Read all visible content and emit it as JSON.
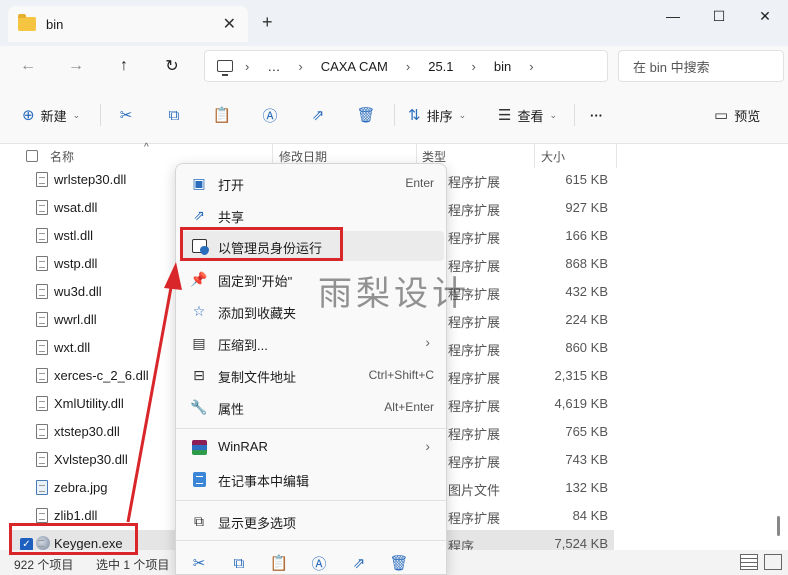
{
  "window": {
    "tab_title": "bin",
    "tab_close": "✕",
    "new_tab": "+",
    "minimize": "—",
    "maximize": "☐",
    "close": "✕"
  },
  "nav": {
    "back": "←",
    "forward": "→",
    "up": "↑",
    "refresh": "↻",
    "breadcrumb": [
      "…",
      "CAXA CAM",
      "25.1",
      "bin"
    ],
    "search_placeholder": "在 bin 中搜索"
  },
  "commands": {
    "new_label": "新建",
    "sort_label": "排序",
    "view_label": "查看",
    "more": "···",
    "preview_label": "预览"
  },
  "columns": {
    "name": "名称",
    "modified": "修改日期",
    "type": "类型",
    "size": "大小"
  },
  "files": [
    {
      "name": "wrlstep30.dll",
      "type": "程序扩展",
      "size": "615 KB",
      "kind": "dll"
    },
    {
      "name": "wsat.dll",
      "type": "程序扩展",
      "size": "927 KB",
      "kind": "dll"
    },
    {
      "name": "wstl.dll",
      "type": "程序扩展",
      "size": "166 KB",
      "kind": "dll"
    },
    {
      "name": "wstp.dll",
      "type": "程序扩展",
      "size": "868 KB",
      "kind": "dll"
    },
    {
      "name": "wu3d.dll",
      "type": "程序扩展",
      "size": "432 KB",
      "kind": "dll"
    },
    {
      "name": "wwrl.dll",
      "type": "程序扩展",
      "size": "224 KB",
      "kind": "dll"
    },
    {
      "name": "wxt.dll",
      "type": "程序扩展",
      "size": "860 KB",
      "kind": "dll"
    },
    {
      "name": "xerces-c_2_6.dll",
      "type": "程序扩展",
      "size": "2,315 KB",
      "kind": "dll"
    },
    {
      "name": "XmlUtility.dll",
      "type": "程序扩展",
      "size": "4,619 KB",
      "kind": "dll"
    },
    {
      "name": "xtstep30.dll",
      "type": "程序扩展",
      "size": "765 KB",
      "kind": "dll"
    },
    {
      "name": "Xvlstep30.dll",
      "type": "程序扩展",
      "size": "743 KB",
      "kind": "dll"
    },
    {
      "name": "zebra.jpg",
      "type": "图片文件",
      "size": "132 KB",
      "kind": "img"
    },
    {
      "name": "zlib1.dll",
      "type": "程序扩展",
      "size": "84 KB",
      "kind": "dll"
    },
    {
      "name": "Keygen.exe",
      "type": "程序",
      "size": "7,524 KB",
      "kind": "exe",
      "selected": true
    }
  ],
  "status": {
    "item_count": "922 个项目",
    "selected": "选中 1 个项目"
  },
  "context_menu": {
    "open": "打开",
    "open_key": "Enter",
    "share": "共享",
    "run_as_admin": "以管理员身份运行",
    "pin_start": "固定到\"开始\"",
    "add_favorites": "添加到收藏夹",
    "compress": "压缩到...",
    "copy_path": "复制文件地址",
    "copy_path_key": "Ctrl+Shift+C",
    "properties": "属性",
    "properties_key": "Alt+Enter",
    "winrar": "WinRAR",
    "edit_notepad": "在记事本中编辑",
    "more_options": "显示更多选项",
    "submenu_arrow": "›"
  },
  "watermark": "雨梨设计",
  "colors": {
    "accent": "#2a6dbd",
    "highlight_red": "#d9262a"
  }
}
